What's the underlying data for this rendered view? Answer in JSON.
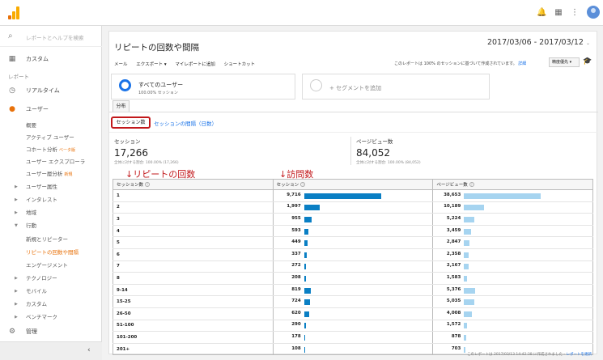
{
  "topbar": {
    "icons": [
      "bell-icon",
      "apps-icon",
      "more-icon",
      "account-icon"
    ]
  },
  "sidebar": {
    "search_placeholder": "レポートとヘルプを検索",
    "customize": "カスタム",
    "section_report": "レポート",
    "realtime": "リアルタイム",
    "user": "ユーザー",
    "sub1": "概要",
    "sub2": "アクティブ ユーザー",
    "sub3": "コホート分析",
    "sub3_badge": "ベータ版",
    "sub4": "ユーザー エクスプローラ",
    "sub5": "ユーザー層分析",
    "sub5_badge": "新規",
    "exp1": "ユーザー属性",
    "exp2": "インタレスト",
    "exp3": "地域",
    "exp4": "行動",
    "sub6": "新規とリピーター",
    "sub7": "リピートの回数や間隔",
    "sub8": "エンゲージメント",
    "exp5": "テクノロジー",
    "exp6": "モバイル",
    "exp7": "カスタム",
    "exp8": "ベンチマーク",
    "admin": "管理"
  },
  "main": {
    "title": "リピートの回数や間隔",
    "date_range": "2017/03/06 - 2017/03/12",
    "toolbar": [
      "メール",
      "エクスポート ▾",
      "マイレポートに追加",
      "ショートカット"
    ],
    "note": "このレポートは 100% のセッションに基づいて作成されています。",
    "note_link": "詳細",
    "precision": "精度優先",
    "seg1_title": "すべてのユーザー",
    "seg1_sub": "100.00% セッション",
    "seg2_title": "+ セグメントを追加",
    "tab": "分布",
    "view_tab1": "セッション数",
    "view_tab2": "セッションの間隔（日数）",
    "metric1_label": "セッション",
    "metric1_value": "17,266",
    "metric1_sub": "全体に対する割合: 100.00% (17,266)",
    "metric2_label": "ページビュー数",
    "metric2_value": "84,052",
    "metric2_sub": "全体に対する割合: 100.00% (84,052)",
    "annot1": "↓リピートの回数",
    "annot2": "↓訪問数",
    "col1": "セッション数",
    "col2": "セッション",
    "col3": "ページビュー数",
    "footer": "このレポートは 2017/03/13 14:42:38 に作成されました -",
    "footer_link": "レポートを更新",
    "colors": {
      "sessions_bar": "#0a7fc4",
      "pageviews_bar": "#a6d4f0",
      "accent": "#c2181b"
    }
  },
  "rows": [
    {
      "label": "1",
      "sessions": "9,716",
      "s": 9716,
      "pageviews": "38,653",
      "p": 38653
    },
    {
      "label": "2",
      "sessions": "1,997",
      "s": 1997,
      "pageviews": "10,189",
      "p": 10189
    },
    {
      "label": "3",
      "sessions": "955",
      "s": 955,
      "pageviews": "5,224",
      "p": 5224
    },
    {
      "label": "4",
      "sessions": "593",
      "s": 593,
      "pageviews": "3,459",
      "p": 3459
    },
    {
      "label": "5",
      "sessions": "449",
      "s": 449,
      "pageviews": "2,847",
      "p": 2847
    },
    {
      "label": "6",
      "sessions": "337",
      "s": 337,
      "pageviews": "2,358",
      "p": 2358
    },
    {
      "label": "7",
      "sessions": "272",
      "s": 272,
      "pageviews": "2,167",
      "p": 2167
    },
    {
      "label": "8",
      "sessions": "208",
      "s": 208,
      "pageviews": "1,583",
      "p": 1583
    },
    {
      "label": "9-14",
      "sessions": "819",
      "s": 819,
      "pageviews": "5,376",
      "p": 5376
    },
    {
      "label": "15-25",
      "sessions": "724",
      "s": 724,
      "pageviews": "5,035",
      "p": 5035
    },
    {
      "label": "26-50",
      "sessions": "620",
      "s": 620,
      "pageviews": "4,008",
      "p": 4008
    },
    {
      "label": "51-100",
      "sessions": "290",
      "s": 290,
      "pageviews": "1,572",
      "p": 1572
    },
    {
      "label": "101-200",
      "sessions": "178",
      "s": 178,
      "pageviews": "878",
      "p": 878
    },
    {
      "label": "201+",
      "sessions": "108",
      "s": 108,
      "pageviews": "703",
      "p": 703
    }
  ]
}
